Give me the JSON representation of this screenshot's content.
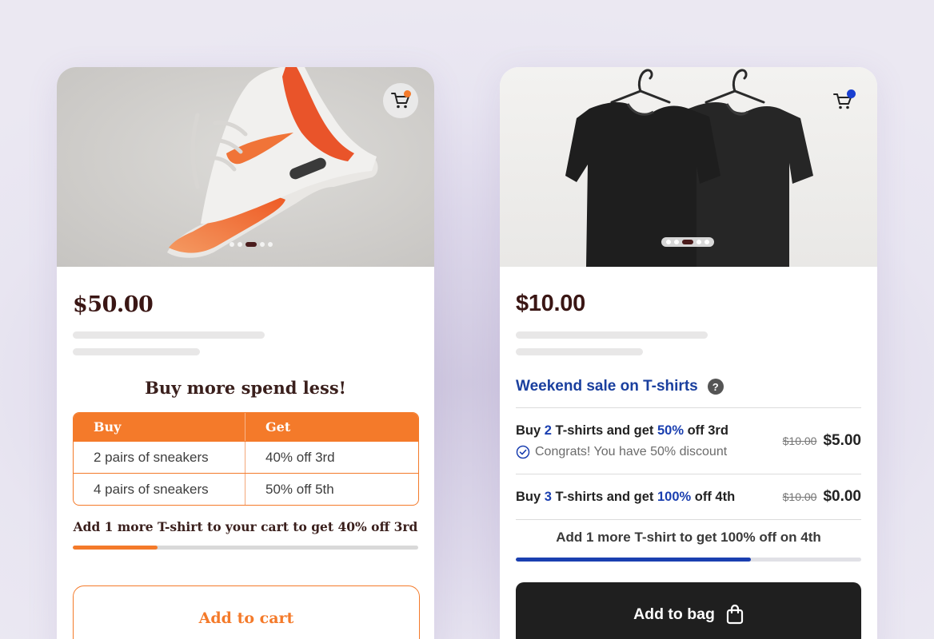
{
  "colors": {
    "accent_orange": "#f47a2a",
    "accent_blue": "#1a3fb0",
    "price_brown": "#3a1614",
    "bag_button_bg": "#1f1f1f"
  },
  "card_a": {
    "image": {
      "subject": "orange-white-sneaker",
      "pager_active_index": 2,
      "pager_count": 5
    },
    "cart_icon": "cart-icon",
    "price": "$50.00",
    "promo_title": "Buy more spend less!",
    "table": {
      "headers": [
        "Buy",
        "Get"
      ],
      "rows": [
        {
          "buy": "2 pairs of sneakers",
          "get": "40% off 3rd"
        },
        {
          "buy": "4 pairs of sneakers",
          "get": "50% off 5th"
        }
      ]
    },
    "progress_message": "Add 1 more T-shirt to your cart to get 40% off 3rd",
    "progress_fraction": 0.245,
    "button_label": "Add to cart"
  },
  "card_b": {
    "image": {
      "subject": "two-black-tshirts-on-hangers",
      "pager_active_index": 2,
      "pager_count": 5
    },
    "cart_icon": "cart-icon",
    "price": "$10.00",
    "sale_title": "Weekend sale on T-shirts",
    "help_icon": "?",
    "tiers": [
      {
        "pre": "Buy ",
        "qty": "2",
        "mid": " T-shirts and get ",
        "pct": "50%",
        "post": " off 3rd",
        "congrats": "Congrats! You have 50% discount",
        "old_price": "$10.00",
        "new_price": "$5.00"
      },
      {
        "pre": "Buy ",
        "qty": "3",
        "mid": " T-shirts and get ",
        "pct": "100%",
        "post": " off 4th",
        "old_price": "$10.00",
        "new_price": "$0.00"
      }
    ],
    "progress_message": "Add 1 more T-shirt to get 100% off on 4th",
    "progress_fraction": 0.68,
    "button_label": "Add to bag",
    "button_icon": "shopping-bag-icon"
  }
}
